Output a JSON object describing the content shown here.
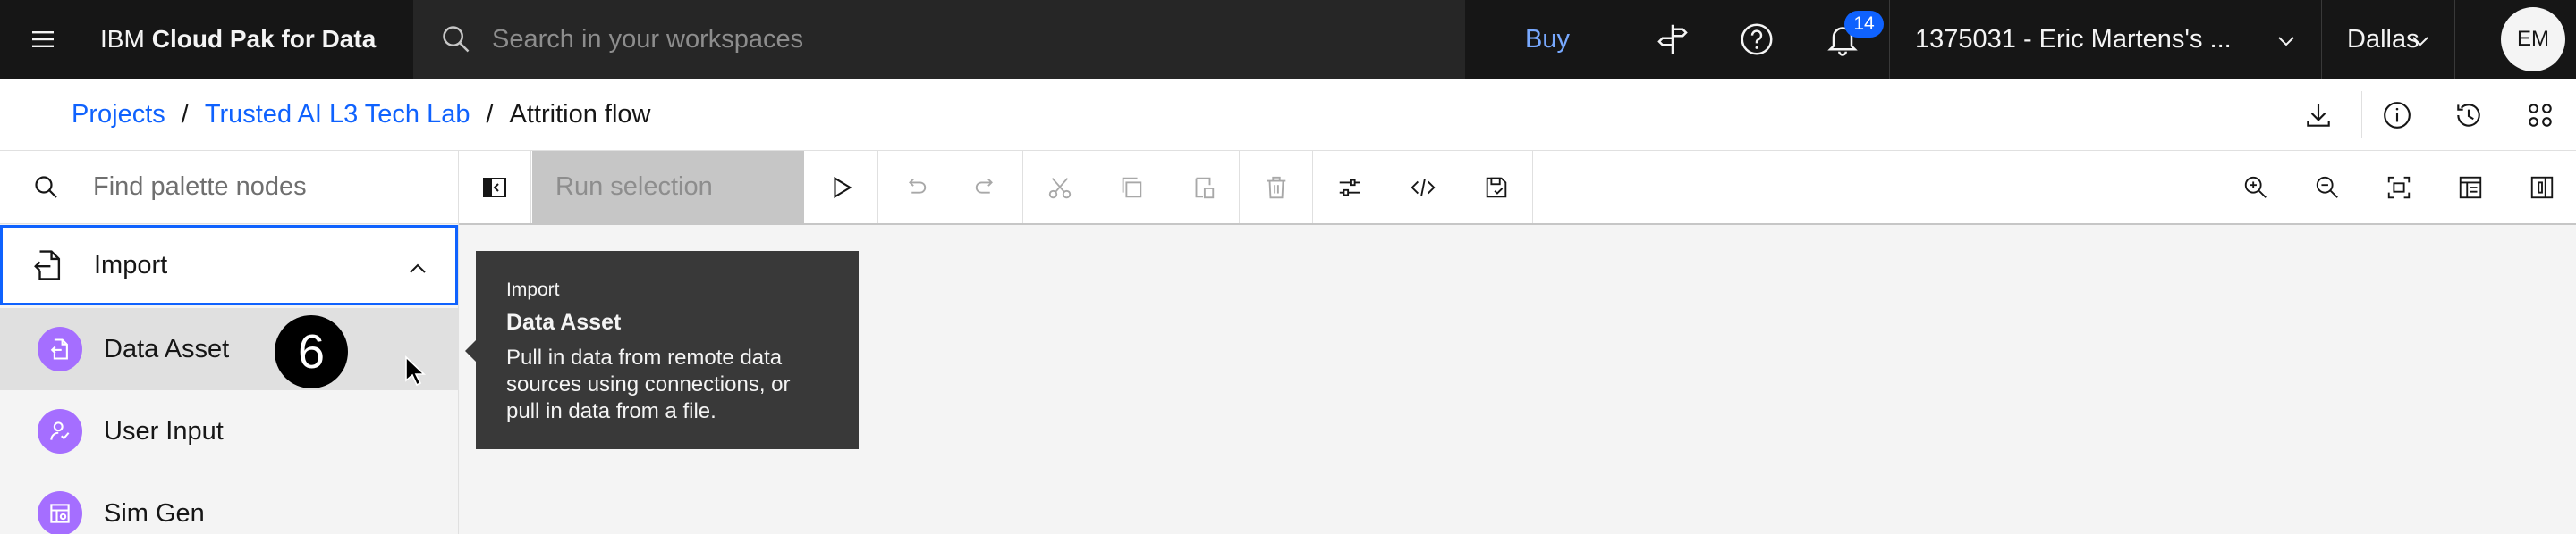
{
  "header": {
    "brand_prefix": "IBM",
    "brand_name": "Cloud Pak for Data",
    "search_placeholder": "Search in your workspaces",
    "buy_label": "Buy",
    "notification_count": "14",
    "account_label": "1375031 - Eric Martens's ...",
    "region_label": "Dallas",
    "avatar_initials": "EM"
  },
  "breadcrumb": {
    "items": [
      "Projects",
      "Trusted AI L3 Tech Lab"
    ],
    "separator": "/",
    "current": "Attrition flow"
  },
  "palette": {
    "search_placeholder": "Find palette nodes",
    "category": {
      "label": "Import",
      "expanded": true
    },
    "items": [
      {
        "label": "Data Asset",
        "icon": "data-asset-icon",
        "hovered": true
      },
      {
        "label": "User Input",
        "icon": "user-input-icon"
      },
      {
        "label": "Sim Gen",
        "icon": "sim-gen-icon"
      }
    ]
  },
  "toolbar": {
    "run_selection_label": "Run selection"
  },
  "tooltip": {
    "category": "Import",
    "title": "Data Asset",
    "description": "Pull in data from remote data sources using connections, or pull in data from a file."
  },
  "step_marker": "6",
  "colors": {
    "header_bg": "#161616",
    "accent": "#0f62fe",
    "node_purple": "#a56eff",
    "tooltip_bg": "#393939"
  }
}
